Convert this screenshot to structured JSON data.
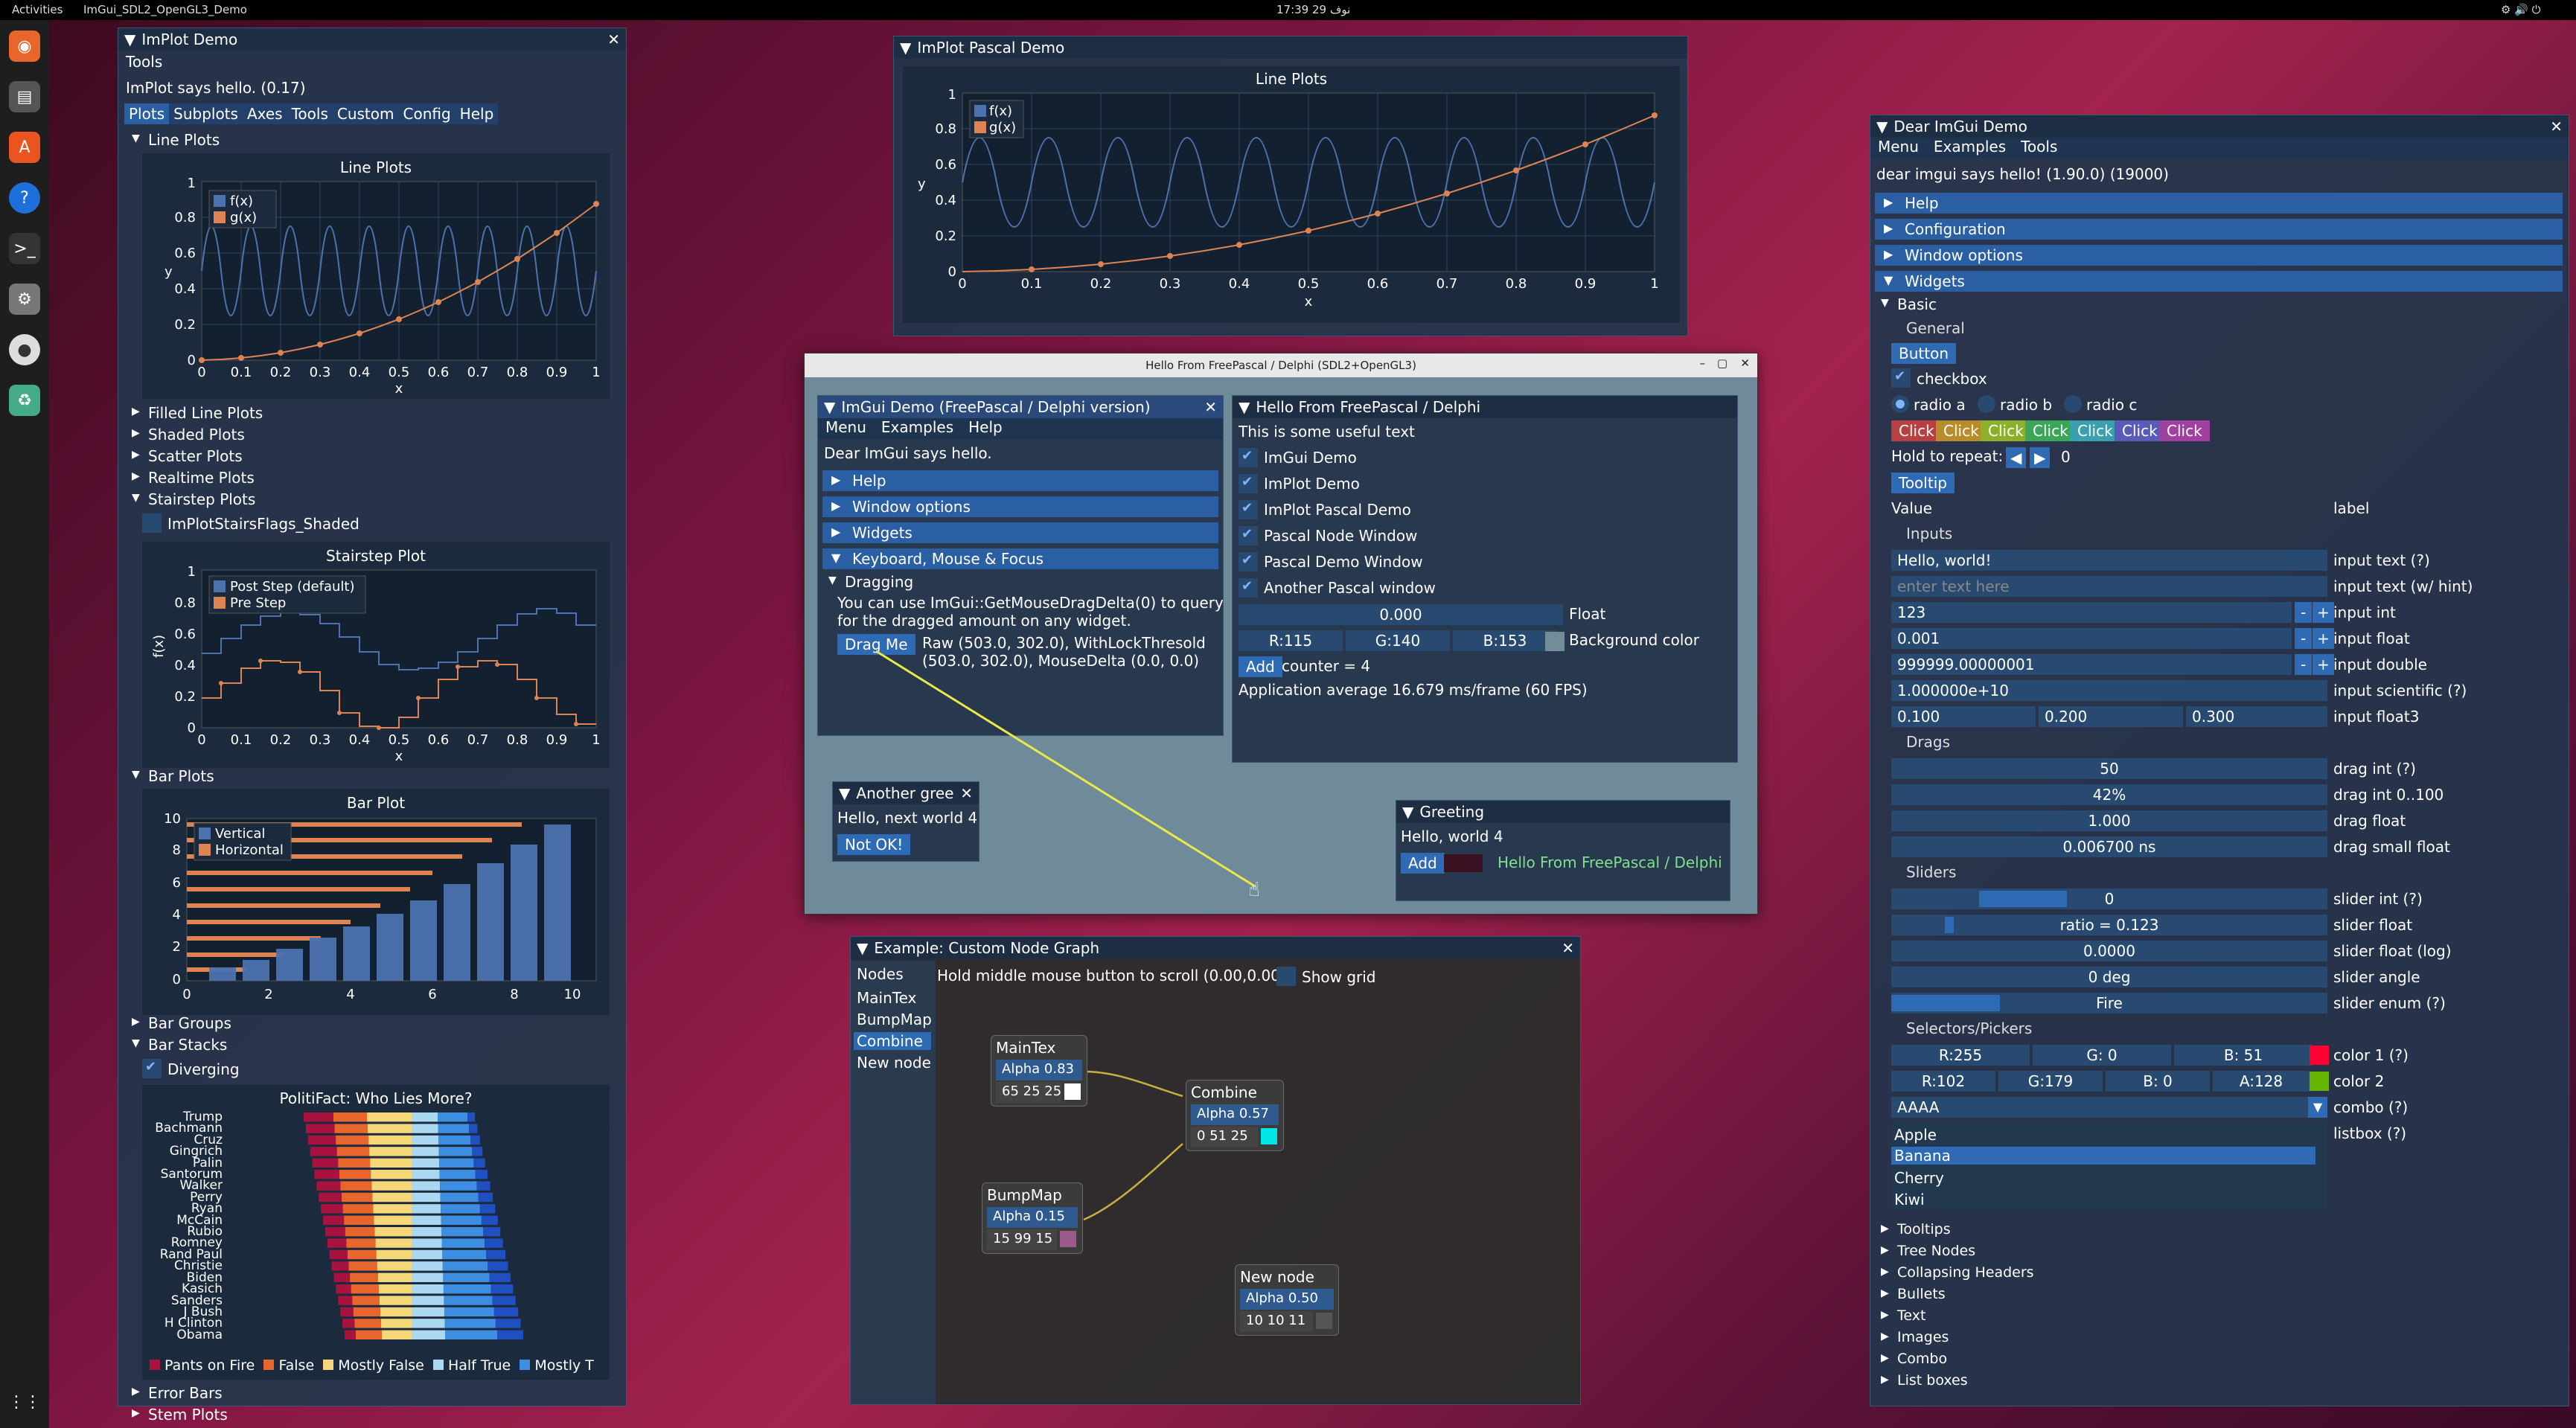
{
  "topbar": {
    "activities": "Activities",
    "app": "ImGui_SDL2_OpenGL3_Demo",
    "clock": "17:39 29 نوف"
  },
  "implot": {
    "title": "ImPlot Demo",
    "tools_label": "Tools",
    "hello": "ImPlot says hello. (0.17)",
    "tabs": [
      "Plots",
      "Subplots",
      "Axes",
      "Tools",
      "Custom",
      "Config",
      "Help"
    ],
    "line_plots": "Line Plots",
    "line_plot_title": "Line Plots",
    "legend_fx": "f(x)",
    "legend_gx": "g(x)",
    "xlabel": "x",
    "ylabel": "y",
    "sections": [
      "Filled Line Plots",
      "Shaded Plots",
      "Scatter Plots",
      "Realtime Plots"
    ],
    "stairstep": "Stairstep Plots",
    "stairs_flag": "ImPlotStairsFlags_Shaded",
    "stairs_title": "Stairstep Plot",
    "stairs_post": "Post Step (default)",
    "stairs_pre": "Pre Step",
    "stairs_ylabel": "f(x)",
    "bar_plots": "Bar Plots",
    "bar_title": "Bar Plot",
    "bar_vertical": "Vertical",
    "bar_horizontal": "Horizontal",
    "bar_groups": "Bar Groups",
    "bar_stacks": "Bar Stacks",
    "diverging": "Diverging",
    "politifact_title": "PolitiFact: Who Lies More?",
    "politicians": [
      "Trump",
      "Bachmann",
      "Cruz",
      "Gingrich",
      "Palin",
      "Santorum",
      "Walker",
      "Perry",
      "Ryan",
      "McCain",
      "Rubio",
      "Romney",
      "Rand Paul",
      "Christie",
      "Biden",
      "Kasich",
      "Sanders",
      "J Bush",
      "H Clinton",
      "Obama"
    ],
    "politifact_legend": [
      "Pants on Fire",
      "False",
      "Mostly False",
      "Half True",
      "Mostly T"
    ],
    "more": [
      "Error Bars",
      "Stem Plots"
    ]
  },
  "pascal": {
    "title": "ImPlot Pascal Demo",
    "plot_title": "Line Plots",
    "legend_fx": "f(x)",
    "legend_gx": "g(x)",
    "xlabel": "x",
    "ylabel": "y"
  },
  "hello": {
    "title": "Hello From FreePascal / Delphi (SDL2+OpenGL3)",
    "demo_title": "ImGui Demo (FreePascal / Delphi version)",
    "menu": [
      "Menu",
      "Examples",
      "Help"
    ],
    "says": "Dear ImGui says hello.",
    "headers": [
      "Help",
      "Window options",
      "Widgets",
      "Keyboard, Mouse & Focus"
    ],
    "dragging": "Dragging",
    "drag_text1": "You can use ImGui::GetMouseDragDelta(0) to query",
    "drag_text2": "for the dragged amount on any widget.",
    "drag_button": "Drag Me",
    "drag_info1": "Raw (503.0, 302.0), WithLockThresold",
    "drag_info2": "(503.0, 302.0), MouseDelta (0.0, 0.0)",
    "fp_title": "Hello From FreePascal / Delphi",
    "fp_text": "This is some useful text",
    "fp_checks": [
      "ImGui Demo",
      "ImPlot Demo",
      "ImPlot Pascal Demo",
      "Pascal Node Window",
      "Pascal Demo Window",
      "Another Pascal window"
    ],
    "float_value": "0.000",
    "float_label": "Float",
    "r": "R:115",
    "g": "G:140",
    "b": "B:153",
    "bg_label": "Background color",
    "add": "Add",
    "counter": "counter = 4",
    "avg": "Application average 16.679 ms/frame (60 FPS)",
    "another_title": "Another gree",
    "another_text": "Hello, next world 4",
    "not_ok": "Not OK!",
    "greeting_title": "Greeting",
    "greeting_text": "Hello, world 4",
    "greeting_add": "Add",
    "greeting_msg": "Hello From FreePascal / Delphi"
  },
  "nodes": {
    "title": "Example: Custom Node Graph",
    "list_title": "Nodes",
    "items": [
      "MainTex",
      "BumpMap",
      "Combine",
      "New node"
    ],
    "hint": "Hold middle mouse button to scroll (0.00,0.00)",
    "show_grid": "Show grid",
    "maintex": {
      "name": "MainTex",
      "alpha": "Alpha 0.83",
      "color": "65 25 25"
    },
    "combine": {
      "name": "Combine",
      "alpha": "Alpha 0.57",
      "color": "0 51 25"
    },
    "bumpmap": {
      "name": "BumpMap",
      "alpha": "Alpha 0.15",
      "color": "15 99 15"
    },
    "newnode": {
      "name": "New node",
      "alpha": "Alpha 0.50",
      "color": "10 10 11"
    }
  },
  "dear": {
    "title": "Dear ImGui Demo",
    "menu": [
      "Menu",
      "Examples",
      "Tools"
    ],
    "hello": "dear imgui says hello! (1.90.0) (19000)",
    "headers": [
      "Help",
      "Configuration",
      "Window options",
      "Widgets"
    ],
    "basic": "Basic",
    "general": "General",
    "button": "Button",
    "checkbox": "checkbox",
    "radios": [
      "radio a",
      "radio b",
      "radio c"
    ],
    "click": "Click",
    "hold": "Hold to repeat:",
    "hold_val": "0",
    "tooltip": "Tooltip",
    "value": "Value",
    "label": "label",
    "inputs": "Inputs",
    "in_text": "Hello, world!",
    "in_text_l": "input text (?)",
    "in_hint": "enter text here",
    "in_hint_l": "input text (w/ hint)",
    "in_int": "123",
    "in_int_l": "input int",
    "in_float": "0.001",
    "in_float_l": "input float",
    "in_double": "999999.00000001",
    "in_double_l": "input double",
    "in_sci": "1.000000e+10",
    "in_sci_l": "input scientific (?)",
    "f3": [
      "0.100",
      "0.200",
      "0.300"
    ],
    "f3_l": "input float3",
    "drags": "Drags",
    "d_int": "50",
    "d_int_l": "drag int (?)",
    "d_pct": "42%",
    "d_pct_l": "drag int 0..100",
    "d_float": "1.000",
    "d_float_l": "drag float",
    "d_small": "0.006700 ns",
    "d_small_l": "drag small float",
    "sliders": "Sliders",
    "s_int": "0",
    "s_int_l": "slider int (?)",
    "s_ratio": "ratio = 0.123",
    "s_ratio_l": "slider float",
    "s_log": "0.0000",
    "s_log_l": "slider float (log)",
    "s_angle": "0 deg",
    "s_angle_l": "slider angle",
    "s_enum": "Fire",
    "s_enum_l": "slider enum (?)",
    "pickers": "Selectors/Pickers",
    "c1": [
      "R:255",
      "G: 0",
      "B: 51"
    ],
    "c1_l": "color 1 (?)",
    "c2": [
      "R:102",
      "G:179",
      "B: 0",
      "A:128"
    ],
    "c2_l": "color 2",
    "combo": "AAAA",
    "combo_l": "combo (?)",
    "listbox": [
      "Apple",
      "Banana",
      "Cherry",
      "Kiwi"
    ],
    "listbox_l": "listbox (?)",
    "trees": [
      "Tooltips",
      "Tree Nodes",
      "Collapsing Headers",
      "Bullets",
      "Text",
      "Images",
      "Combo",
      "List boxes"
    ]
  },
  "colors": {
    "fx": "#4c72b0",
    "gx": "#dd8452",
    "accent": "#2f6ab5",
    "yellow": "#e8e84a"
  }
}
